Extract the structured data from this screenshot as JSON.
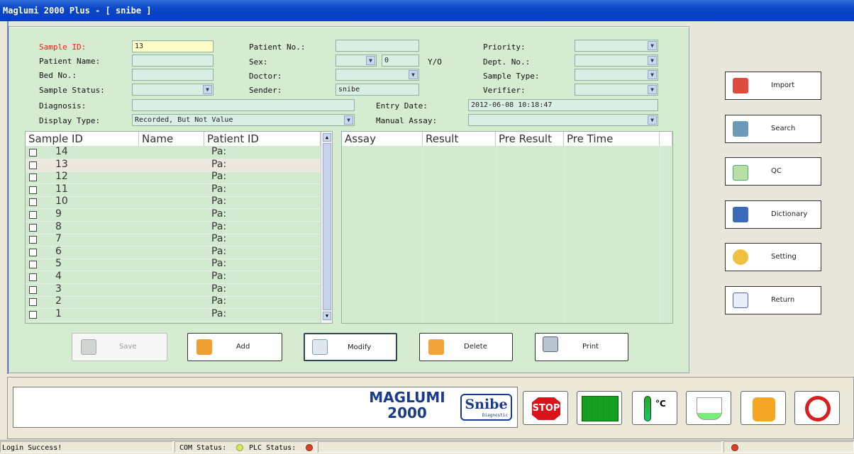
{
  "window": {
    "title": "Maglumi 2000 Plus - [ snibe ]"
  },
  "form": {
    "sample_id_label": "Sample ID:",
    "sample_id_value": "13",
    "patient_name_label": "Patient Name:",
    "bed_no_label": "Bed No.:",
    "sample_status_label": "Sample Status:",
    "diagnosis_label": "Diagnosis:",
    "display_type_label": "Display Type:",
    "display_type_value": "Recorded, But Not Value",
    "patient_no_label": "Patient No.:",
    "sex_label": "Sex:",
    "age_value": "0",
    "age_unit": "Y/O",
    "doctor_label": "Doctor:",
    "sender_label": "Sender:",
    "sender_value": "snibe",
    "entry_date_label": "Entry Date:",
    "entry_date_value": "2012-06-08 10:18:47",
    "manual_assay_label": "Manual Assay:",
    "priority_label": "Priority:",
    "dept_no_label": "Dept. No.:",
    "sample_type_label": "Sample Type:",
    "verifier_label": "Verifier:"
  },
  "sample_table": {
    "headers": [
      "Sample ID",
      "Name",
      "Patient ID"
    ],
    "rows": [
      {
        "id": "14",
        "pid": "Pa:"
      },
      {
        "id": "13",
        "pid": "Pa:"
      },
      {
        "id": "12",
        "pid": "Pa:"
      },
      {
        "id": "11",
        "pid": "Pa:"
      },
      {
        "id": "10",
        "pid": "Pa:"
      },
      {
        "id": "9",
        "pid": "Pa:"
      },
      {
        "id": "8",
        "pid": "Pa:"
      },
      {
        "id": "7",
        "pid": "Pa:"
      },
      {
        "id": "6",
        "pid": "Pa:"
      },
      {
        "id": "5",
        "pid": "Pa:"
      },
      {
        "id": "4",
        "pid": "Pa:"
      },
      {
        "id": "3",
        "pid": "Pa:"
      },
      {
        "id": "2",
        "pid": "Pa:"
      },
      {
        "id": "1",
        "pid": "Pa:"
      }
    ]
  },
  "result_table": {
    "headers": [
      "Assay",
      "Result",
      "Pre Result",
      "Pre Time"
    ]
  },
  "actions": {
    "save": "Save",
    "add": "Add",
    "modify": "Modify",
    "delete": "Delete",
    "print": "Print"
  },
  "side": {
    "import": "Import",
    "search": "Search",
    "qc": "QC",
    "dictionary": "Dictionary",
    "setting": "Setting",
    "return": "Return"
  },
  "logo": {
    "line1": "MAGLUMI",
    "line2": "2000",
    "brand": "Snibe",
    "brand_sub": "Diagnostic"
  },
  "toolbar": {
    "stop": "STOP",
    "temp_unit": "°C"
  },
  "statusbar": {
    "login": "Login Success!",
    "com": "COM Status:",
    "plc": "PLC Status:"
  }
}
